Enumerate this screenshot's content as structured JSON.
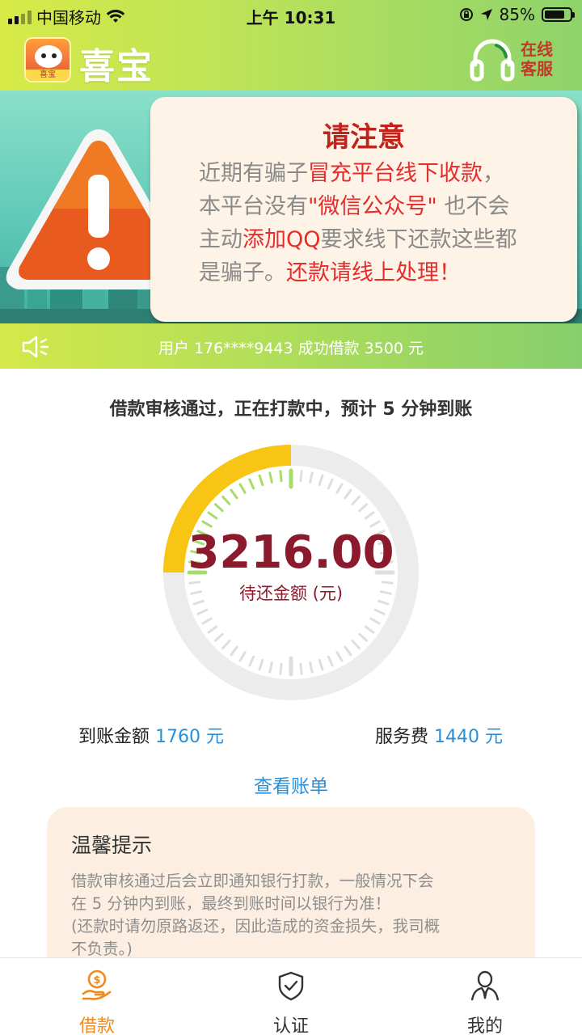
{
  "status_bar": {
    "carrier": "中国移动",
    "time": "上午 10:31",
    "battery_percent": "85%"
  },
  "header": {
    "app_name": "喜宝",
    "logo_tag": "喜宝",
    "customer_service_line1": "在线",
    "customer_service_line2": "客服"
  },
  "notice": {
    "title": "请注意",
    "p1_a": "近期有骗子",
    "p1_b": "冒充平台线下收款",
    "p1_c": "，",
    "p2_a": "本平台没有",
    "p2_b": "\"微信公众号\"",
    "p2_c": " 也不会",
    "p3_a": "主动",
    "p3_b": "添加QQ",
    "p3_c": "要求线下还款这些都",
    "p4_a": "是骗子。",
    "p4_b": "还款请线上处理！"
  },
  "ticker": {
    "text": "用户 176****9443 成功借款 3500 元"
  },
  "loan": {
    "status_text": "借款审核通过，正在打款中，预计 5 分钟到账",
    "amount": "3216.00",
    "amount_label": "待还金额 (元)",
    "progress_fraction": 0.25,
    "received_label": "到账金额",
    "received_value": "1760 元",
    "fee_label": "服务费",
    "fee_value": "1440 元",
    "view_bill": "查看账单"
  },
  "tips": {
    "title": "温馨提示",
    "line1": "借款审核通过后会立即通知银行打款，一般情况下会",
    "line2": "在 5 分钟内到账，最终到账时间以银行为准！",
    "line3": "(还款时请勿原路返还，因此造成的资金损失，我司概",
    "line4": "不负责。)"
  },
  "tabbar": {
    "tabs": [
      {
        "label": "借款",
        "icon": "loan-icon",
        "active": true
      },
      {
        "label": "认证",
        "icon": "shield-check-icon",
        "active": false
      },
      {
        "label": "我的",
        "icon": "person-icon",
        "active": false
      }
    ]
  },
  "colors": {
    "accent_orange": "#f08a1c",
    "link_blue": "#2a8fd6",
    "amount_red": "#8b1a2c",
    "alert_red": "#e52d2d",
    "gauge_yellow": "#f8c515"
  }
}
